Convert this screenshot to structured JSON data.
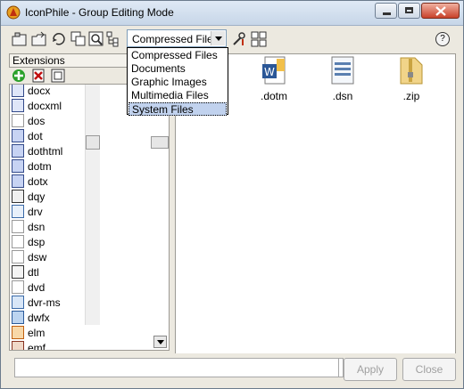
{
  "window": {
    "title": "IconPhile - Group Editing Mode",
    "controls": [
      "minimize",
      "maximize",
      "close"
    ]
  },
  "toolbar": {
    "filter_selected": "Compressed Files",
    "help": "?"
  },
  "dropdown": {
    "options": [
      "Compressed Files",
      "Documents",
      "Graphic Images",
      "Multimedia Files",
      "System Files"
    ],
    "highlighted_index": 4
  },
  "extensions_panel": {
    "header": "Extensions",
    "items": [
      "docx",
      "docxml",
      "dos",
      "dot",
      "dothtml",
      "dotm",
      "dotx",
      "dqy",
      "drv",
      "dsn",
      "dsp",
      "dsw",
      "dtl",
      "dvd",
      "dvr-ms",
      "dwfx",
      "elm",
      "emf"
    ]
  },
  "files": [
    ".dotm",
    ".dsn",
    ".zip"
  ],
  "buttons": {
    "apply": "Apply",
    "close": "Close"
  },
  "colors": {
    "selection": "#c1d2ee",
    "titlebar": "#c7d6e8"
  }
}
